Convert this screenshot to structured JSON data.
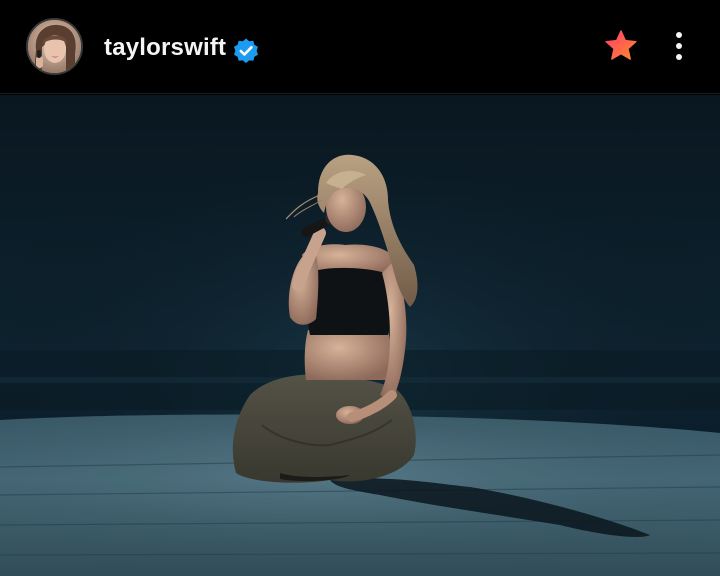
{
  "header": {
    "username": "taylorswift",
    "verified": true,
    "avatar_icon": "profile-avatar",
    "favorite_icon": "gradient-star-icon",
    "more_icon": "vertical-ellipsis-icon"
  },
  "colors": {
    "background": "#000000",
    "username_text": "#f5f5f5",
    "verified_blue": "#1d9bf0",
    "star_gradient_start": "#ff3d6e",
    "star_gradient_end": "#ff8a2a"
  },
  "media": {
    "type": "photo"
  }
}
